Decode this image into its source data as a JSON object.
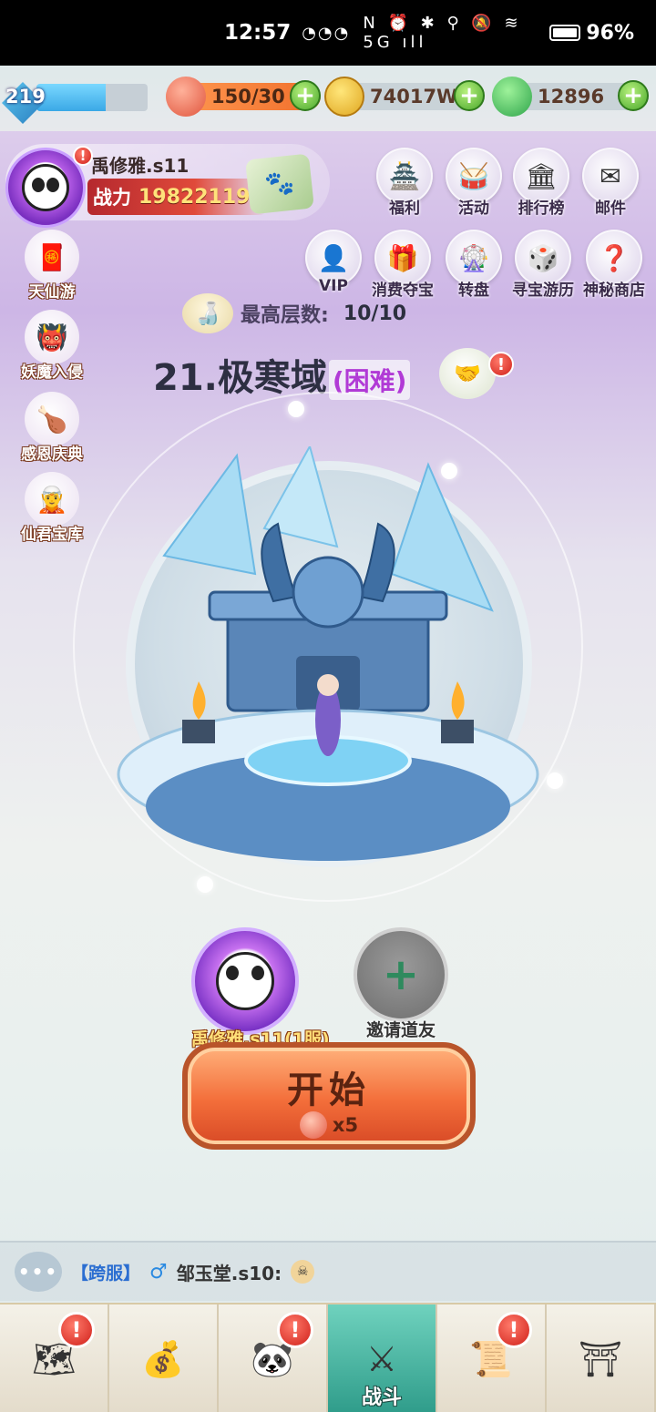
{
  "status_bar": {
    "time": "12:57",
    "battery": "96%",
    "notification_icons": "◔◔◔",
    "system_icons": "N ⏰ ✱ ⚲ 🔕 ≋ 5G ıll"
  },
  "resources": {
    "level": "219",
    "exp_fraction": 0.62,
    "stamina": "150/30",
    "gold": "74017W",
    "jade": "12896"
  },
  "player": {
    "name": "禹修雅.s11",
    "power_label": "战力",
    "power_value": "19822119",
    "alert": "!"
  },
  "activities_row1": [
    {
      "label": "福利",
      "icon": "welfare-icon",
      "glyph": "🏯"
    },
    {
      "label": "活动",
      "icon": "event-icon",
      "glyph": "🥁"
    },
    {
      "label": "排行榜",
      "icon": "ranking-icon",
      "glyph": "🏛"
    },
    {
      "label": "邮件",
      "icon": "mail-icon",
      "glyph": "✉"
    }
  ],
  "activities_row2": [
    {
      "label": "VIP",
      "icon": "vip-icon",
      "glyph": "👤"
    },
    {
      "label": "消费夺宝",
      "icon": "treasure-chest-icon",
      "glyph": "🎁"
    },
    {
      "label": "转盘",
      "icon": "wheel-icon",
      "glyph": "🎡"
    },
    {
      "label": "寻宝游历",
      "icon": "dice-icon",
      "glyph": "🎲"
    },
    {
      "label": "神秘商店",
      "icon": "mystery-shop-icon",
      "glyph": "❓"
    }
  ],
  "side_events": [
    {
      "label": "天仙游",
      "icon": "fortune-bag-icon",
      "glyph": "🧧"
    },
    {
      "label": "妖魔入侵",
      "icon": "demon-icon",
      "glyph": "👹"
    },
    {
      "label": "感恩庆典",
      "icon": "roast-turkey-icon",
      "glyph": "🍗"
    },
    {
      "label": "仙君宝库",
      "icon": "immortal-icon",
      "glyph": "🧝"
    }
  ],
  "stage": {
    "max_floor_label": "最高层数:",
    "max_floor_value": "10/10",
    "title": "21.极寒域",
    "difficulty": "(困难)",
    "alert": "!"
  },
  "team": {
    "member_name": "禹修雅.s11(1服)",
    "invite_label": "邀请道友",
    "invite_symbol": "+"
  },
  "start_button": {
    "label": "开始",
    "cost": "x5"
  },
  "chat": {
    "icon_text": "•••",
    "tag": "【跨服】",
    "gender": "♂",
    "user": "邹玉堂.s10:",
    "emoji": "☠"
  },
  "bottom_nav": [
    {
      "icon": "map-icon",
      "glyph": "🗺",
      "alert": "!"
    },
    {
      "icon": "bag-icon",
      "glyph": "💰",
      "alert": ""
    },
    {
      "icon": "panda-hero-icon",
      "glyph": "🐼",
      "alert": "!"
    },
    {
      "icon": "battle-icon",
      "glyph": "⚔",
      "label": "战斗",
      "alert": ""
    },
    {
      "icon": "scroll-book-icon",
      "glyph": "📜",
      "alert": "!"
    },
    {
      "icon": "pavilion-icon",
      "glyph": "⛩",
      "alert": ""
    }
  ],
  "colors": {
    "accent_red": "#d0201a",
    "plus_green": "#4aa82c",
    "difficulty_purple": "#b13ad6",
    "start_orange": "#f36e3a"
  }
}
